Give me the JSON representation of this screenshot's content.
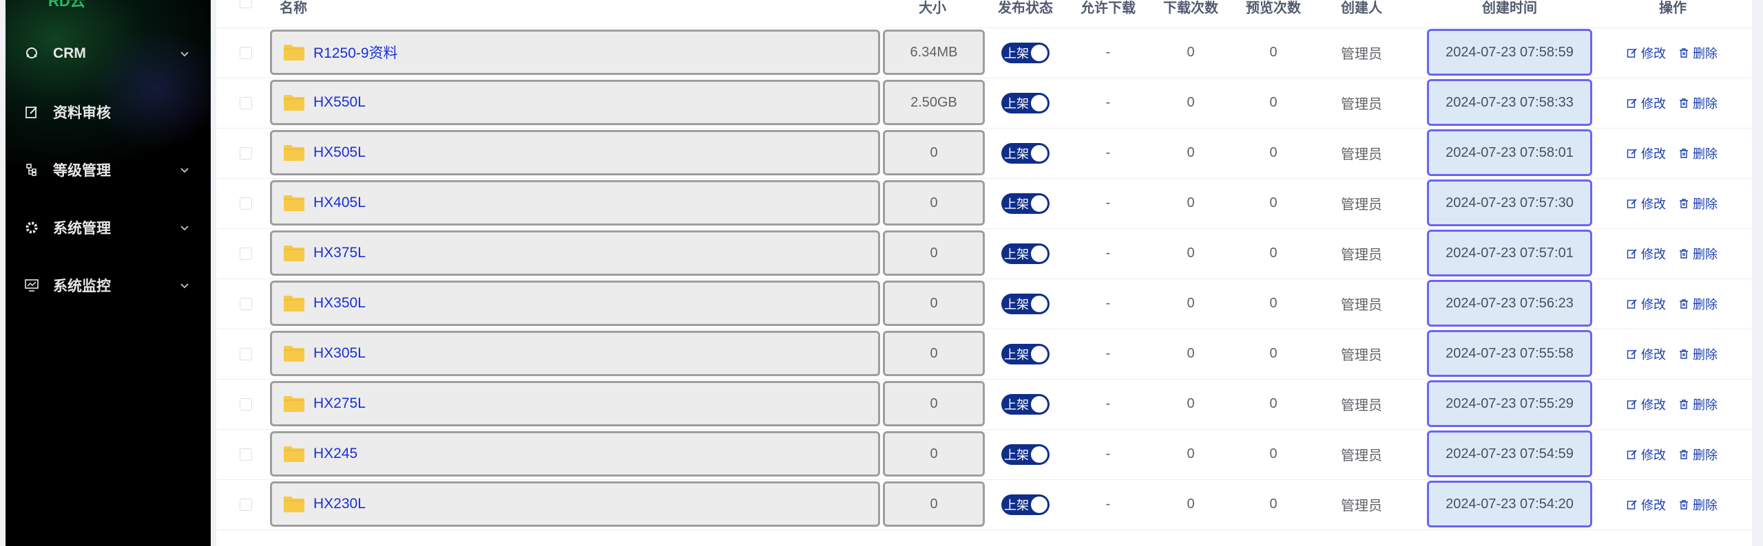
{
  "sidebar": {
    "partial_top_item": "RD云",
    "items": [
      {
        "label": "CRM",
        "icon": "customer-icon",
        "has_children": true
      },
      {
        "label": "资料审核",
        "icon": "edit-icon",
        "has_children": false
      },
      {
        "label": "等级管理",
        "icon": "tree-icon",
        "has_children": true
      },
      {
        "label": "系统管理",
        "icon": "gear-icon",
        "has_children": true
      },
      {
        "label": "系统监控",
        "icon": "monitor-icon",
        "has_children": true
      }
    ]
  },
  "table": {
    "headers": {
      "name": "名称",
      "size": "大小",
      "publish_status": "发布状态",
      "allow_download": "允许下载",
      "download_count": "下载次数",
      "preview_count": "预览次数",
      "creator": "创建人",
      "created_at": "创建时间",
      "actions": "操作"
    },
    "switch_label": "上架",
    "edit_label": "修改",
    "delete_label": "删除",
    "rows": [
      {
        "name": "R1250-9资料",
        "size": "6.34MB",
        "allow_download": "-",
        "downloads": "0",
        "previews": "0",
        "creator": "管理员",
        "created_at": "2024-07-23 07:58:59",
        "published": true
      },
      {
        "name": "HX550L",
        "size": "2.50GB",
        "allow_download": "-",
        "downloads": "0",
        "previews": "0",
        "creator": "管理员",
        "created_at": "2024-07-23 07:58:33",
        "published": true
      },
      {
        "name": "HX505L",
        "size": "0",
        "allow_download": "-",
        "downloads": "0",
        "previews": "0",
        "creator": "管理员",
        "created_at": "2024-07-23 07:58:01",
        "published": true
      },
      {
        "name": "HX405L",
        "size": "0",
        "allow_download": "-",
        "downloads": "0",
        "previews": "0",
        "creator": "管理员",
        "created_at": "2024-07-23 07:57:30",
        "published": true
      },
      {
        "name": "HX375L",
        "size": "0",
        "allow_download": "-",
        "downloads": "0",
        "previews": "0",
        "creator": "管理员",
        "created_at": "2024-07-23 07:57:01",
        "published": true
      },
      {
        "name": "HX350L",
        "size": "0",
        "allow_download": "-",
        "downloads": "0",
        "previews": "0",
        "creator": "管理员",
        "created_at": "2024-07-23 07:56:23",
        "published": true
      },
      {
        "name": "HX305L",
        "size": "0",
        "allow_download": "-",
        "downloads": "0",
        "previews": "0",
        "creator": "管理员",
        "created_at": "2024-07-23 07:55:58",
        "published": true
      },
      {
        "name": "HX275L",
        "size": "0",
        "allow_download": "-",
        "downloads": "0",
        "previews": "0",
        "creator": "管理员",
        "created_at": "2024-07-23 07:55:29",
        "published": true
      },
      {
        "name": "HX245",
        "size": "0",
        "allow_download": "-",
        "downloads": "0",
        "previews": "0",
        "creator": "管理员",
        "created_at": "2024-07-23 07:54:59",
        "published": true
      },
      {
        "name": "HX230L",
        "size": "0",
        "allow_download": "-",
        "downloads": "0",
        "previews": "0",
        "creator": "管理员",
        "created_at": "2024-07-23 07:54:20",
        "published": true
      }
    ]
  },
  "colors": {
    "sidebar_bg": "#000000",
    "switch_on": "#0f2e8a",
    "link": "#1a30d6",
    "action_link": "#1a3fb0",
    "folder": "#f7c948",
    "time_highlight_border": "#6b63f5"
  }
}
